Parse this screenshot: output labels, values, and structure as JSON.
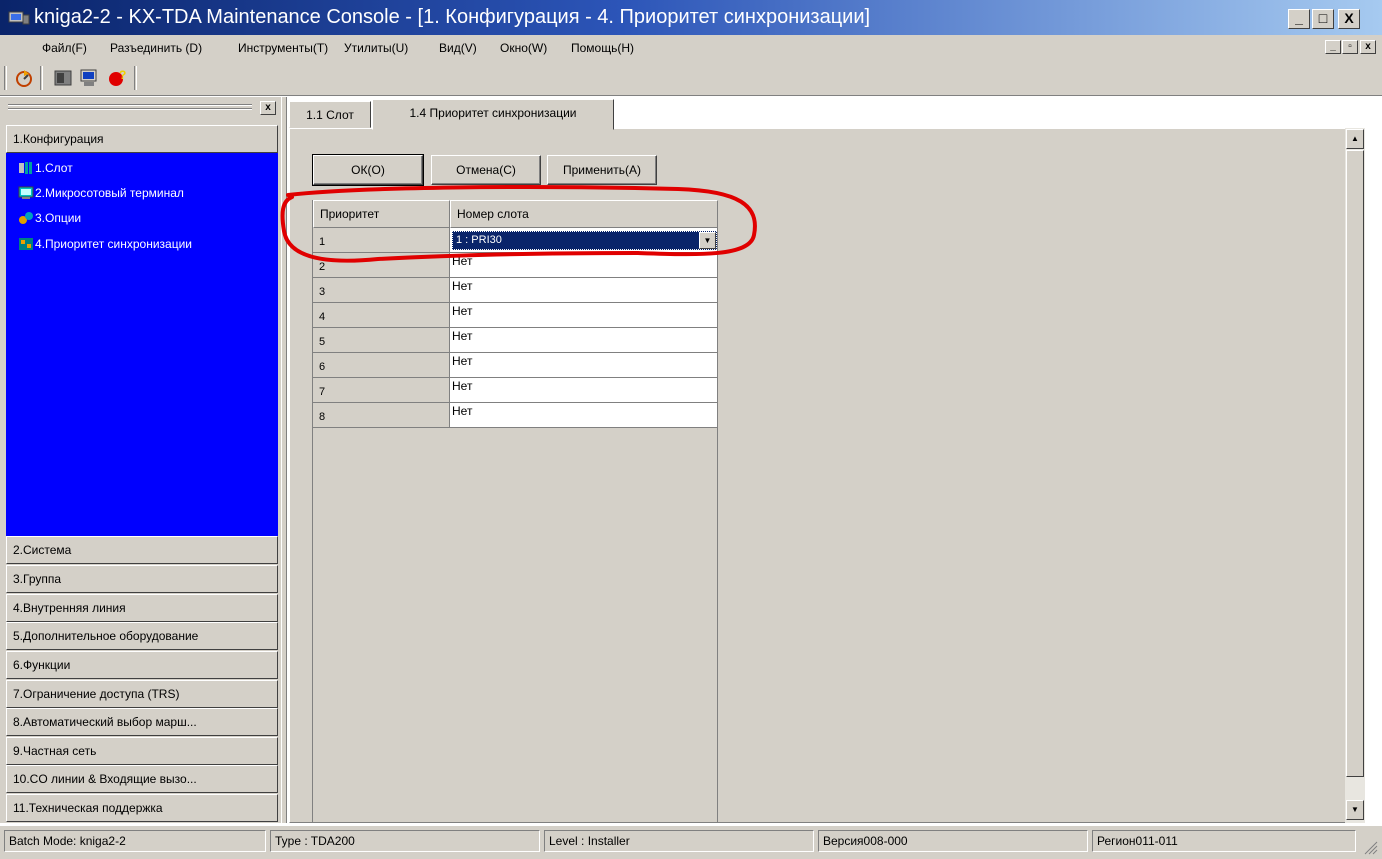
{
  "window": {
    "title": "kniga2-2 - KX-TDA Maintenance Console - [1. Конфигурация - 4. Приоритет синхронизации]",
    "minimize": "_",
    "maximize": "□",
    "close": "X"
  },
  "menubar": {
    "items": [
      "Файл(F)",
      "Разъединить (D)",
      "Инструменты(T)",
      "Утилиты(U)",
      "Вид(V)",
      "Окно(W)",
      "Помощь(H)"
    ],
    "mdi_minimize": "_",
    "mdi_restore": "▫",
    "mdi_close": "x"
  },
  "toolbar": {
    "icons": [
      "connect-icon",
      "disconnect-icon",
      "terminal-icon",
      "help-icon"
    ]
  },
  "leftpane": {
    "close": "x",
    "active_category": "1.Конфигурация",
    "sub_items": [
      {
        "label": "1.Слот",
        "icon": "slot-icon"
      },
      {
        "label": "2.Микросотовый терминал",
        "icon": "terminal-icon"
      },
      {
        "label": "3.Опции",
        "icon": "options-icon"
      },
      {
        "label": "4.Приоритет синхронизации",
        "icon": "sync-icon"
      }
    ],
    "categories": [
      "2.Система",
      "3.Группа",
      "4.Внутренняя линия",
      "5.Дополнительное оборудование",
      "6.Функции",
      "7.Ограничение доступа (TRS)",
      "8.Автоматический выбор марш...",
      "9.Частная сеть",
      "10.CO линии & Входящие вызо...",
      "11.Техническая поддержка"
    ]
  },
  "tabs": [
    {
      "label": "1.1 Слот",
      "active": false
    },
    {
      "label": "1.4 Приоритет синхронизации",
      "active": true
    }
  ],
  "buttons": {
    "ok": "ОК(O)",
    "cancel": "Отмена(C)",
    "apply": "Применить(A)"
  },
  "grid": {
    "headers": [
      "Приоритет",
      "Номер слота"
    ],
    "rows": [
      {
        "priority": "1",
        "slot": "1 : PRI30"
      },
      {
        "priority": "2",
        "slot": "Нет"
      },
      {
        "priority": "3",
        "slot": "Нет"
      },
      {
        "priority": "4",
        "slot": "Нет"
      },
      {
        "priority": "5",
        "slot": "Нет"
      },
      {
        "priority": "6",
        "slot": "Нет"
      },
      {
        "priority": "7",
        "slot": "Нет"
      },
      {
        "priority": "8",
        "slot": "Нет"
      }
    ],
    "selected_value": "1 : PRI30"
  },
  "scrollbar": {
    "up": "▲",
    "down": "▼"
  },
  "status": {
    "mode": "Batch Mode: kniga2-2",
    "type": "Type : TDA200",
    "level": "Level : Installer",
    "version": "Версия008-000",
    "region": "Регион011-011"
  },
  "colors": {
    "title_gradient_start": "#0a246a",
    "title_gradient_end": "#a6caf0",
    "nav_blue": "#0000ff",
    "annotation_red": "#e00000",
    "face": "#d4d0c8"
  }
}
